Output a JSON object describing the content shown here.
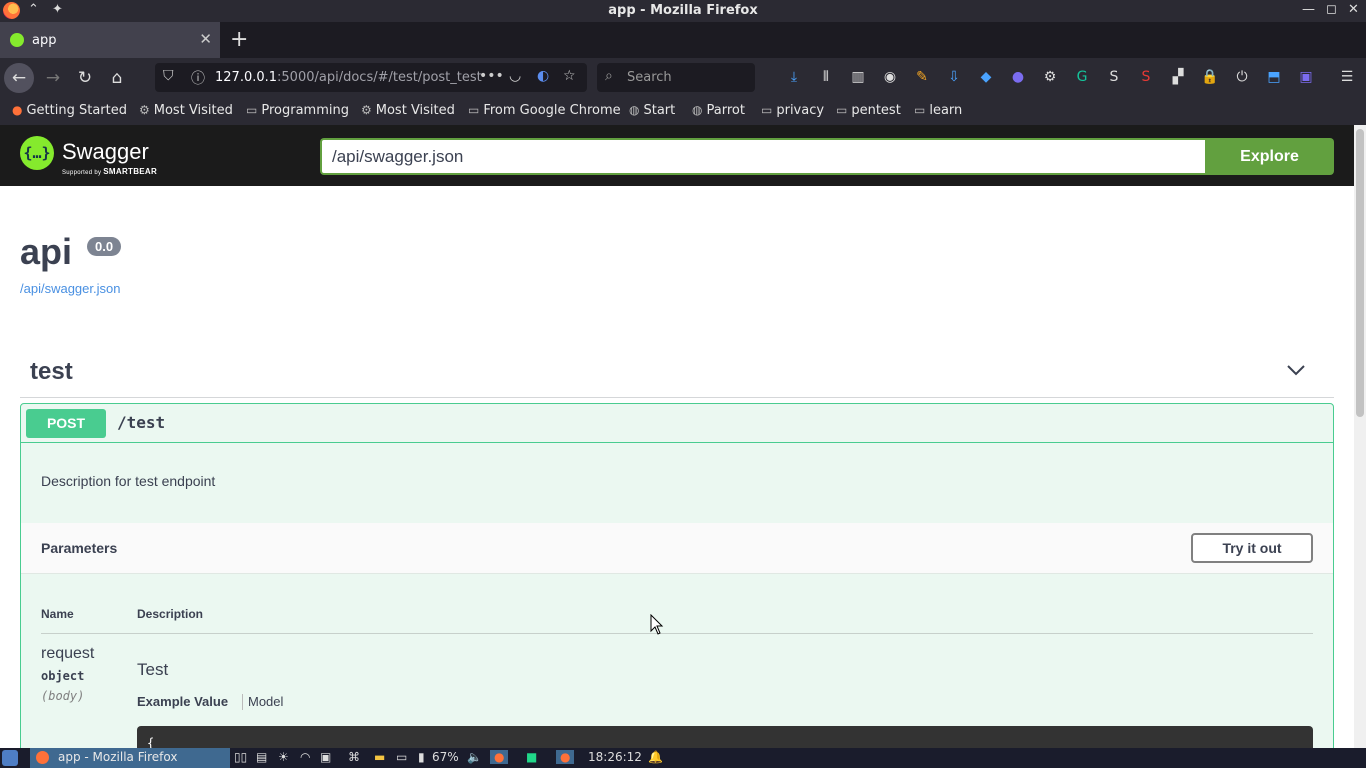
{
  "window": {
    "title": "app - Mozilla Firefox"
  },
  "tabs": [
    {
      "label": "app"
    }
  ],
  "navbar": {
    "url_host": "127.0.0.1",
    "url_rest": ":5000/api/docs/#/test/post_test",
    "search_placeholder": "Search"
  },
  "bookmarks": [
    {
      "label": "Getting Started",
      "icon": "firefox-icon"
    },
    {
      "label": "Most Visited",
      "icon": "gear-icon"
    },
    {
      "label": "Programming",
      "icon": "folder-icon"
    },
    {
      "label": "Most Visited",
      "icon": "gear-icon"
    },
    {
      "label": "From Google Chrome",
      "icon": "folder-icon"
    },
    {
      "label": "Start",
      "icon": "globe-icon"
    },
    {
      "label": "Parrot",
      "icon": "globe-icon"
    },
    {
      "label": "privacy",
      "icon": "folder-icon"
    },
    {
      "label": "pentest",
      "icon": "folder-icon"
    },
    {
      "label": "learn",
      "icon": "folder-icon"
    }
  ],
  "swagger": {
    "brand": "Swagger",
    "brand_sub_prefix": "Supported by",
    "brand_sub_company": "SMARTBEAR",
    "spec_url_value": "/api/swagger.json",
    "explore_label": "Explore",
    "accent_color": "#85ea2d",
    "explore_color": "#62a03f"
  },
  "info": {
    "title": "api",
    "version": "0.0",
    "url": "/api/swagger.json"
  },
  "tag": {
    "name": "test"
  },
  "operation": {
    "method": "POST",
    "path": "/test",
    "description": "Description for test endpoint",
    "method_color": "#49cc90",
    "parameters_title": "Parameters",
    "try_label": "Try it out",
    "columns": {
      "name": "Name",
      "description": "Description"
    },
    "params": [
      {
        "name": "request",
        "type": "object",
        "in": "(body)",
        "description": "Test",
        "example_tab": "Example Value",
        "model_tab": "Model",
        "example_code": "{"
      }
    ]
  },
  "taskbar": {
    "active_window": "app - Mozilla Firefox",
    "battery": "67%",
    "clock": "18:26:12"
  }
}
